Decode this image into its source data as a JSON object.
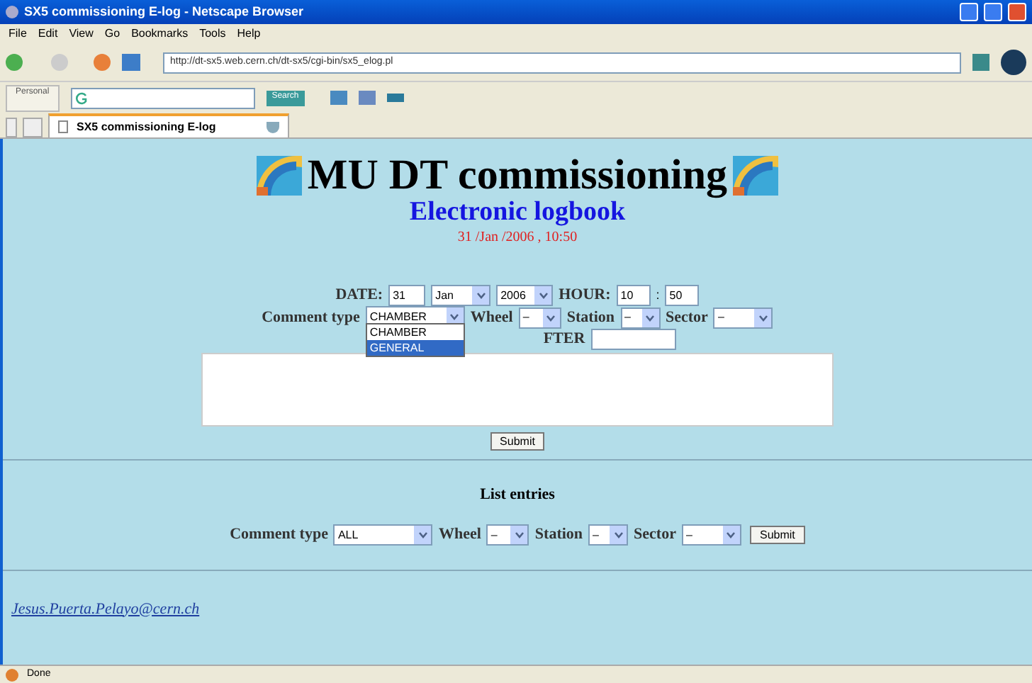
{
  "window": {
    "title": "SX5 commissioning E-log - Netscape Browser"
  },
  "menu": [
    "File",
    "Edit",
    "View",
    "Go",
    "Bookmarks",
    "Tools",
    "Help"
  ],
  "address": {
    "value": "http://dt-sx5.web.cern.ch/dt-sx5/cgi-bin/sx5_elog.pl"
  },
  "toolbar": {
    "personal": "Personal",
    "search_button": "Search"
  },
  "tabs": [
    {
      "label": "SX5 commissioning E-log",
      "selected": true
    }
  ],
  "page": {
    "title": "MU DT commissioning",
    "subtitle": "Electronic logbook",
    "timestamp": "31 /Jan /2006 , 10:50",
    "entry": {
      "date_label": "DATE:",
      "day": "31",
      "month": "Jan",
      "year": "2006",
      "hour_label": "HOUR:",
      "hour": "10",
      "minute_sep": ":",
      "minute": "50",
      "comment_label": "Comment type",
      "comment": "CHAMBER",
      "wheel_label": "Wheel",
      "wheel": "–",
      "station_label": "Station",
      "station": "–",
      "sector_label": "Sector",
      "sector": "–",
      "dropdown": [
        {
          "label": "CHAMBER",
          "selected": false
        },
        {
          "label": "GENERAL",
          "selected": true
        }
      ],
      "after_label": "FTER",
      "submit": "Submit"
    },
    "list": {
      "heading": "List entries",
      "comment_label": "Comment type",
      "comment": "ALL",
      "wheel_label": "Wheel",
      "wheel": "–",
      "station_label": "Station",
      "station": "–",
      "sector_label": "Sector",
      "sector": "–",
      "submit": "Submit"
    },
    "email": "Jesus.Puerta.Pelayo@cern.ch"
  },
  "status_bar": {
    "text": "Done"
  }
}
